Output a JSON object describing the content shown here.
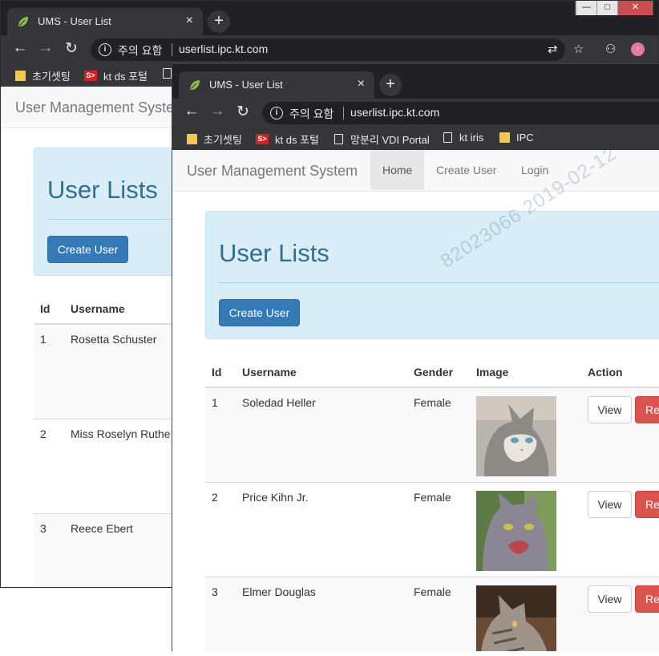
{
  "browser": {
    "tab_title": "UMS - User List",
    "new_tab": "+",
    "close_tab": "×",
    "security_label": "주의 요함",
    "url": "userlist.ipc.kt.com",
    "window_controls": {
      "minimize": "—",
      "maximize": "□",
      "close": "✕"
    },
    "bookmarks": [
      {
        "label": "초기셋팅",
        "icon": "folder-icon"
      },
      {
        "label": "kt ds 포털",
        "icon": "ktds-logo-icon"
      },
      {
        "label": "망분리 VDI Portal",
        "icon": "page-icon"
      },
      {
        "label": "kt iris",
        "icon": "page-icon"
      },
      {
        "label": "IPC",
        "icon": "folder-icon"
      }
    ]
  },
  "app": {
    "brand": "User Management System",
    "nav": [
      "Home",
      "Create User",
      "Login"
    ],
    "heading": "User Lists",
    "create_button": "Create User",
    "watermark": "82023066  2019-02-12"
  },
  "table": {
    "headers": [
      "Id",
      "Username",
      "Gender",
      "Image",
      "Action"
    ],
    "view_label": "View",
    "remove_label": "Re"
  },
  "back_users": [
    {
      "id": "1",
      "username": "Rosetta Schuster"
    },
    {
      "id": "2",
      "username": "Miss Roselyn Ruthe"
    },
    {
      "id": "3",
      "username": "Reece Ebert"
    }
  ],
  "front_users": [
    {
      "id": "1",
      "username": "Soledad Heller",
      "gender": "Female"
    },
    {
      "id": "2",
      "username": "Price Kihn Jr.",
      "gender": "Female"
    },
    {
      "id": "3",
      "username": "Elmer Douglas",
      "gender": "Female"
    }
  ],
  "colors": {
    "primary": "#337ab7",
    "danger": "#d9534f",
    "jumbotron": "#d9edf7",
    "heading": "#31708f"
  }
}
